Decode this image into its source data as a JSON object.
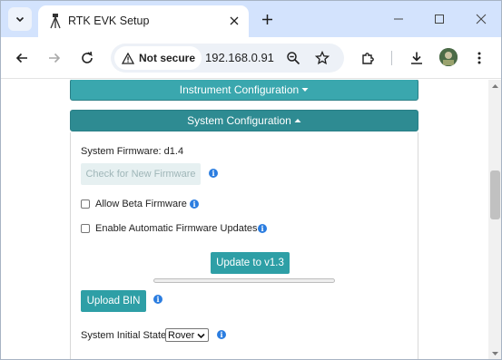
{
  "browser": {
    "tab_title": "RTK EVK Setup",
    "security_label": "Not secure",
    "url": "192.168.0.91"
  },
  "page": {
    "instrument_header": "Instrument Configuration",
    "system_header": "System Configuration",
    "firmware_label": "System Firmware: d1.4",
    "check_firmware_button": "Check for New Firmware",
    "allow_beta_label": "Allow Beta Firmware",
    "allow_beta_checked": false,
    "auto_update_label": "Enable Automatic Firmware Updates",
    "auto_update_checked": false,
    "update_button": "Update to v1.3",
    "update_progress": 0,
    "upload_bin_button": "Upload BIN",
    "initial_state_label": "System Initial State:",
    "initial_state_value": "Rover",
    "accent_color": "#2e9fa6",
    "info_icon": "info-icon"
  }
}
